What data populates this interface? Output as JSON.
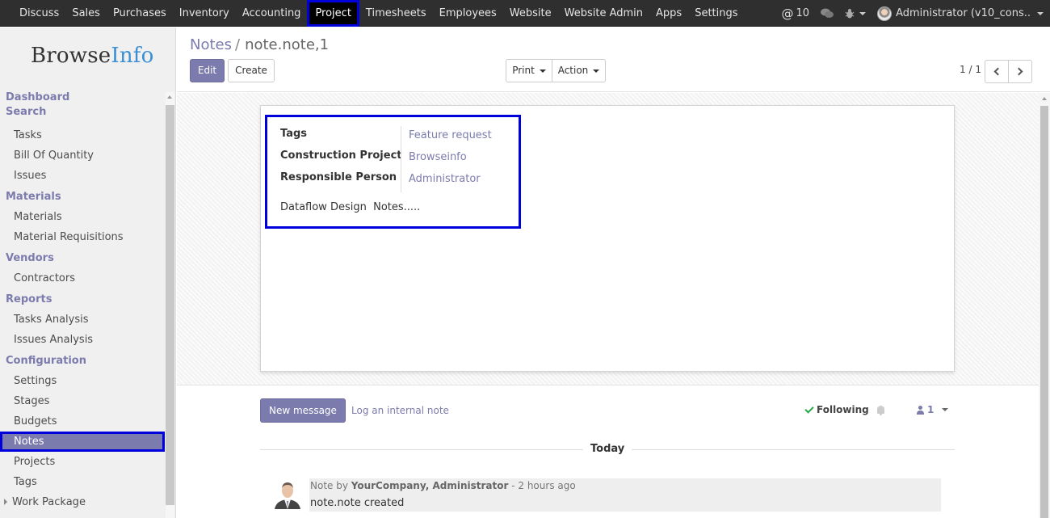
{
  "topbar": {
    "menu": [
      "Discuss",
      "Sales",
      "Purchases",
      "Inventory",
      "Accounting",
      "Project",
      "Timesheets",
      "Employees",
      "Website",
      "Website Admin",
      "Apps",
      "Settings"
    ],
    "active_menu": "Project",
    "mentions_count": "10",
    "user_name": "Administrator (v10_cons.."
  },
  "logo": {
    "part1": "Browse",
    "part2": "Info"
  },
  "sidebar": {
    "dashboard": "Dashboard",
    "search_section": "Search",
    "search_items": [
      "Tasks",
      "Bill Of Quantity",
      "Issues"
    ],
    "materials_section": "Materials",
    "materials_items": [
      "Materials",
      "Material Requisitions"
    ],
    "vendors_section": "Vendors",
    "vendors_items": [
      "Contractors"
    ],
    "reports_section": "Reports",
    "reports_items": [
      "Tasks Analysis",
      "Issues Analysis"
    ],
    "configuration_section": "Configuration",
    "configuration_items": [
      "Settings",
      "Stages",
      "Budgets",
      "Notes",
      "Projects",
      "Tags",
      "Work Package"
    ],
    "active_item": "Notes"
  },
  "control_panel": {
    "breadcrumb_parent": "Notes",
    "breadcrumb_current": "note.note,1",
    "edit_label": "Edit",
    "create_label": "Create",
    "print_label": "Print",
    "action_label": "Action",
    "pager": "1 / 1"
  },
  "form": {
    "fields": [
      {
        "label": "Tags",
        "value": "Feature request"
      },
      {
        "label": "Construction Project",
        "value": "Browseinfo"
      },
      {
        "label": "Responsible Person",
        "value": "Administrator"
      }
    ],
    "note_text": "Dataflow Design  Notes....."
  },
  "chatter": {
    "new_message_label": "New message",
    "log_note_label": "Log an internal note",
    "following_label": "Following",
    "followers_count": "1",
    "date_separator": "Today",
    "messages": [
      {
        "prefix": "Note by ",
        "author": "YourCompany, Administrator",
        "time": " - 2 hours ago",
        "body": "note.note created"
      }
    ]
  },
  "colors": {
    "accent": "#7c7bad",
    "topbar": "#2f2f2f",
    "highlight_outline": "#0000dd",
    "check": "#28a745"
  }
}
